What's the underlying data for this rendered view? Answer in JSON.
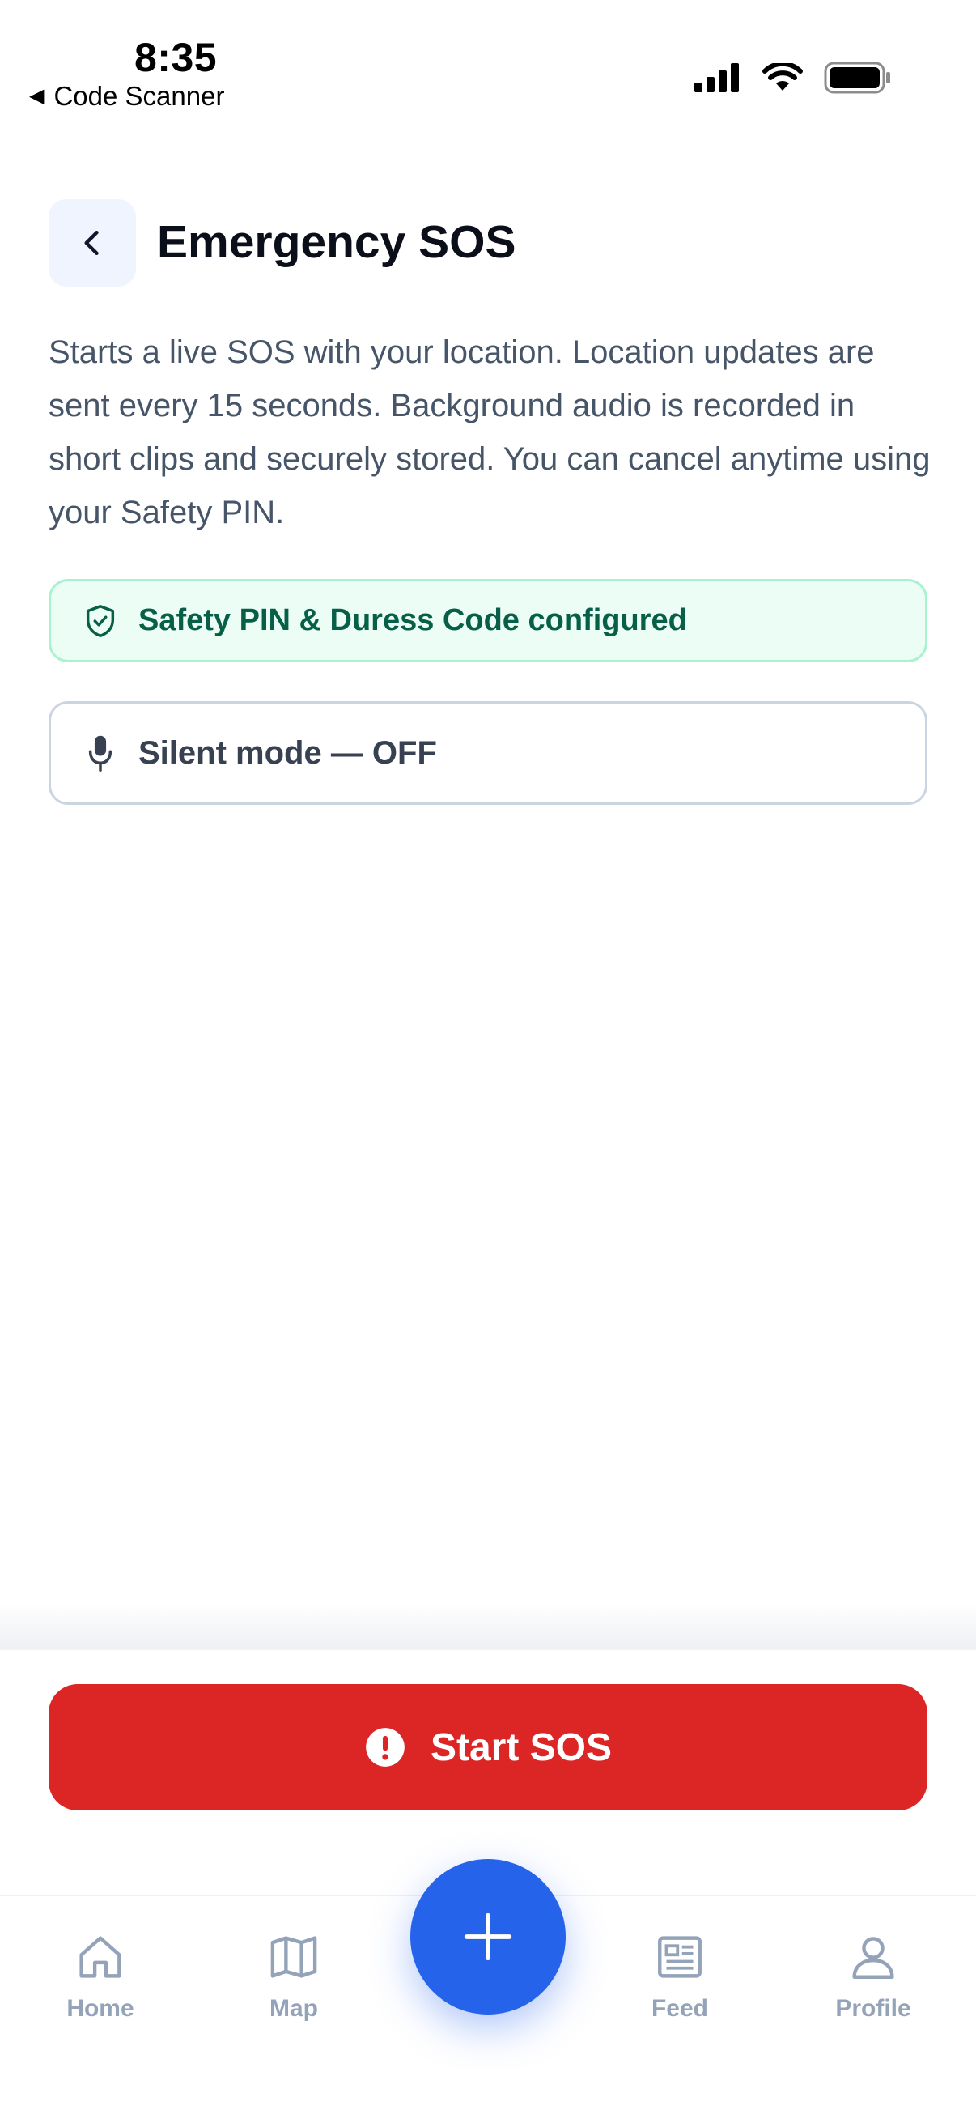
{
  "status_bar": {
    "time": "8:35",
    "back_app": "Code Scanner",
    "icons": [
      "cellular-signal-icon",
      "wifi-icon",
      "battery-icon"
    ]
  },
  "header": {
    "title": "Emergency SOS",
    "back_icon": "chevron-left-icon"
  },
  "description": "Starts a live SOS with your location. Location updates are sent every 15 seconds. Background audio is recorded in short clips and securely stored. You can cancel anytime using your Safety PIN.",
  "pin_status": {
    "icon": "shield-check-icon",
    "label": "Safety PIN & Duress Code configured"
  },
  "silent_mode": {
    "icon": "microphone-icon",
    "label": "Silent mode — OFF"
  },
  "sos_button": {
    "icon": "alert-circle-icon",
    "label": "Start SOS"
  },
  "tabbar": {
    "items": [
      {
        "label": "Home",
        "icon": "home-icon"
      },
      {
        "label": "Map",
        "icon": "map-icon"
      },
      {
        "label": "Feed",
        "icon": "newspaper-icon"
      },
      {
        "label": "Profile",
        "icon": "user-icon"
      }
    ],
    "fab_icon": "plus-icon"
  },
  "colors": {
    "accent_blue": "#2563eb",
    "danger_red": "#dc2626",
    "success_green": "#065f46",
    "success_bg": "#ecfdf5",
    "muted_text": "#475569",
    "tab_inactive": "#94a3b8"
  }
}
